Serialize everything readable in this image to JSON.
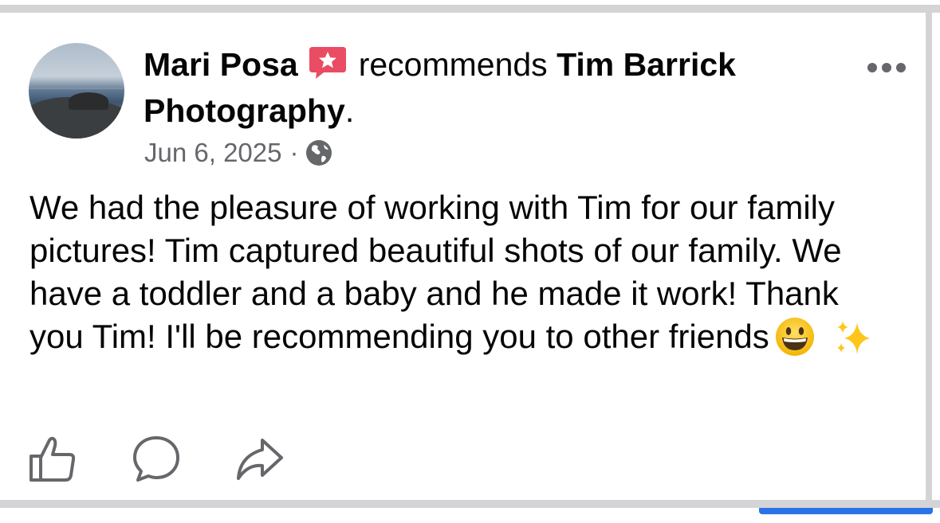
{
  "post": {
    "author_name": "Mari Posa",
    "action_text": "recommends",
    "page_name": "Tim Barrick Photography",
    "trailing_period": ".",
    "date": "Jun 6, 2025",
    "separator": "·",
    "privacy_icon": "globe-icon",
    "recommend_icon": "recommendation-star-icon",
    "more_icon": "more-options-icon",
    "body": "We had the pleasure of working with Tim for our family pictures! Tim captured beautiful shots of our family. We have a toddler and a baby and he made it work! Thank you Tim! I'll be recommending you to other friends",
    "emojis": [
      "grinning-face-emoji",
      "sparkles-emoji"
    ]
  },
  "actions": [
    {
      "icon": "like-thumb-icon"
    },
    {
      "icon": "comment-bubble-icon"
    },
    {
      "icon": "share-arrow-icon"
    }
  ],
  "colors": {
    "text": "#050505",
    "meta": "#65676b",
    "recommend_badge": "#e8475f",
    "border": "#d4d4d6",
    "accent_blue": "#2a73e6"
  }
}
